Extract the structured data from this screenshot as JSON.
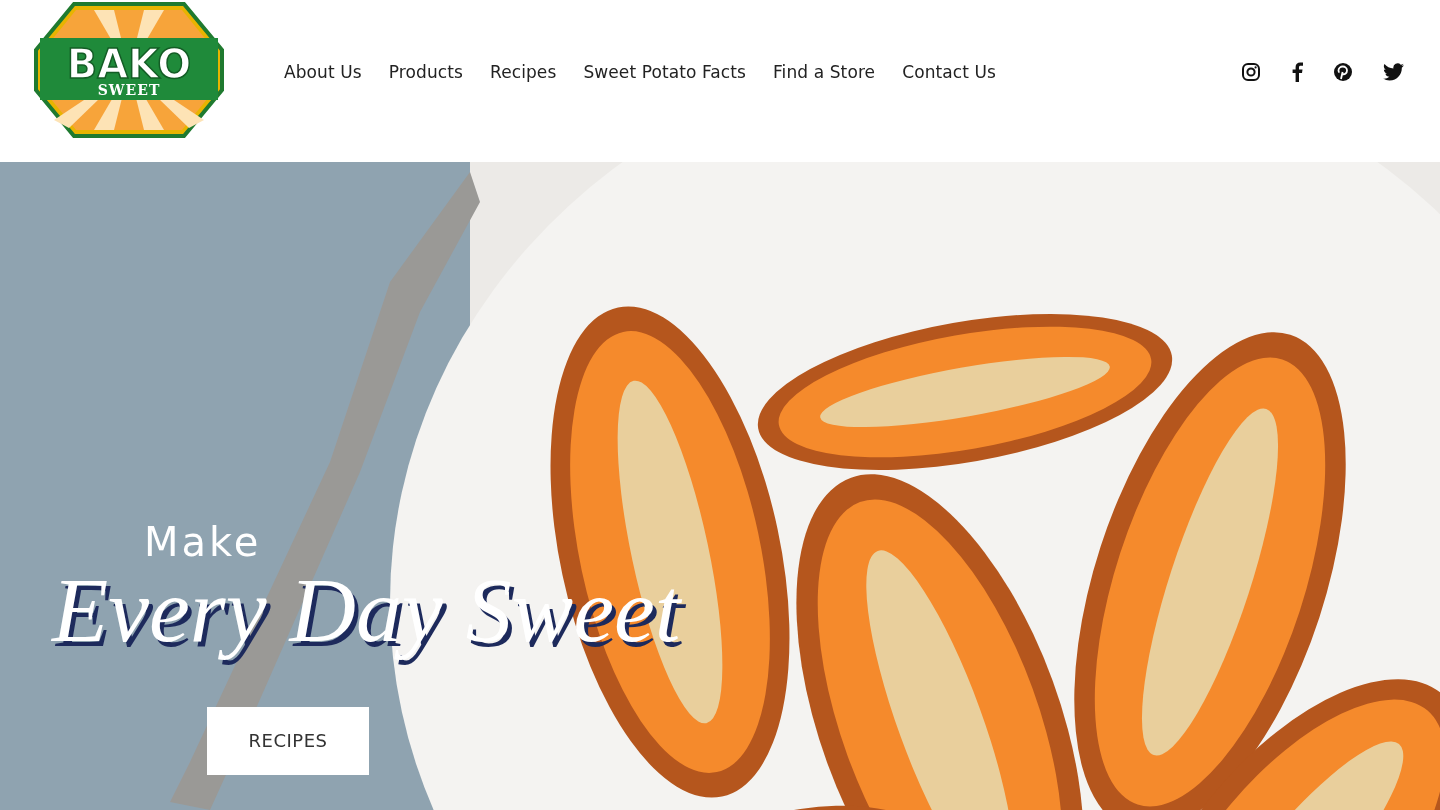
{
  "logo": {
    "word": "BAKO",
    "subword": "SWEET"
  },
  "nav": [
    {
      "label": "About Us"
    },
    {
      "label": "Products"
    },
    {
      "label": "Recipes"
    },
    {
      "label": "Sweet Potato Facts"
    },
    {
      "label": "Find a Store"
    },
    {
      "label": "Contact Us"
    }
  ],
  "hero": {
    "kicker": "Make",
    "headline": "Every Day Sweet",
    "button": "RECIPES"
  }
}
